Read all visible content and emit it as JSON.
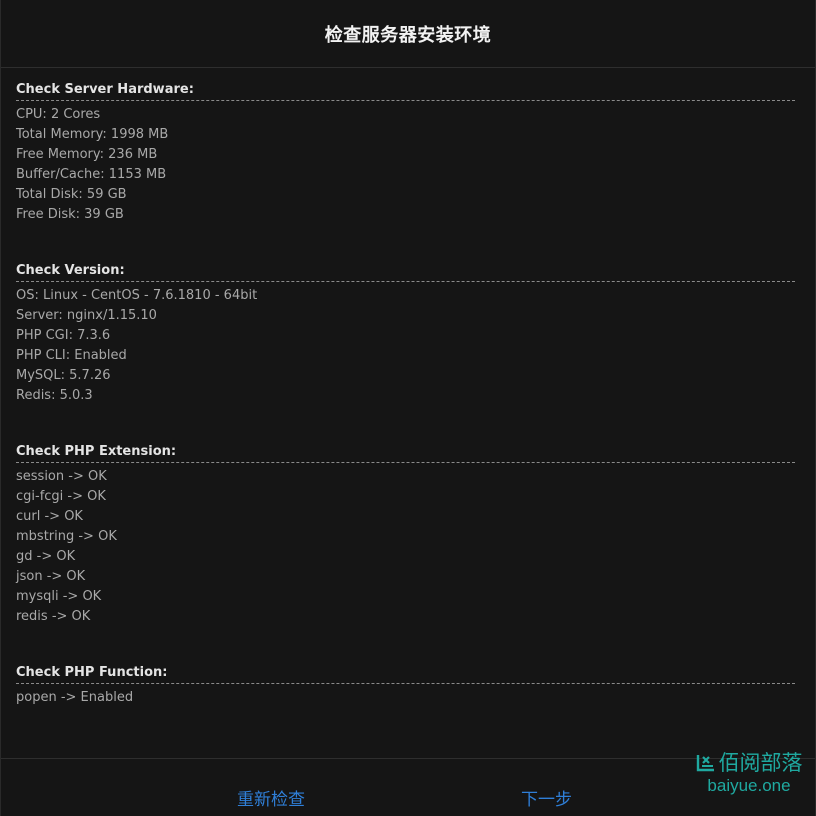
{
  "title": "检查服务器安装环境",
  "sections": [
    {
      "title": "Check Server Hardware:",
      "lines": [
        "CPU: 2 Cores",
        "Total Memory: 1998 MB",
        "Free Memory: 236 MB",
        "Buffer/Cache: 1153 MB",
        "Total Disk: 59 GB",
        "Free Disk: 39 GB"
      ]
    },
    {
      "title": "Check Version:",
      "lines": [
        "OS: Linux - CentOS - 7.6.1810 - 64bit",
        "Server: nginx/1.15.10",
        "PHP CGI: 7.3.6",
        "PHP CLI: Enabled",
        "MySQL: 5.7.26",
        "Redis: 5.0.3"
      ]
    },
    {
      "title": "Check PHP Extension:",
      "lines": [
        "session -> OK",
        "cgi-fcgi -> OK",
        "curl -> OK",
        "mbstring -> OK",
        "gd -> OK",
        "json -> OK",
        "mysqli -> OK",
        "redis -> OK"
      ]
    },
    {
      "title": "Check PHP Function:",
      "lines": [
        "popen -> Enabled"
      ]
    }
  ],
  "footer": {
    "recheck_label": "重新检查",
    "next_label": "下一步"
  },
  "watermark": {
    "brand": "佰阅部落",
    "url": "baiyue.one",
    "color": "#1fa9a0"
  },
  "colors": {
    "background": "#151515",
    "link": "#2f7fd8"
  }
}
